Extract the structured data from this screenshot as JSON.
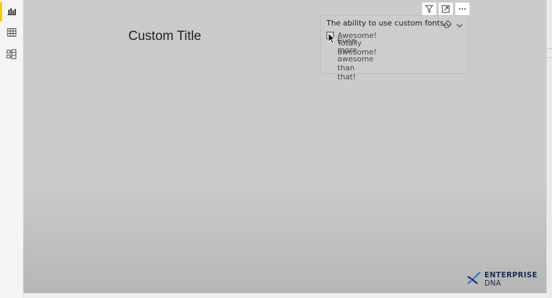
{
  "sidebar": {
    "items": [
      {
        "name": "report-view",
        "icon": "bar-chart-icon",
        "active": true
      },
      {
        "name": "data-view",
        "icon": "table-icon",
        "active": false
      },
      {
        "name": "model-view",
        "icon": "model-icon",
        "active": false
      }
    ],
    "accent_color": "#f2c811"
  },
  "report": {
    "custom_title": "Custom Title"
  },
  "visual_toolbar": {
    "icons": [
      "filter-icon",
      "focus-mode-icon",
      "more-options-icon"
    ]
  },
  "slicer": {
    "header": "The ability to use custom fonts...",
    "header_icons": [
      "eraser-icon",
      "chevron-down-icon"
    ],
    "items": [
      {
        "label": "Awesome!",
        "checked": false
      },
      {
        "label": "Totally awesome!"
      },
      {
        "label": "Even more awesome than that!"
      }
    ]
  },
  "branding": {
    "logo_word1": "ENTERPRISE",
    "logo_word2": "DNA",
    "logo_color": "#1d2b4f"
  }
}
